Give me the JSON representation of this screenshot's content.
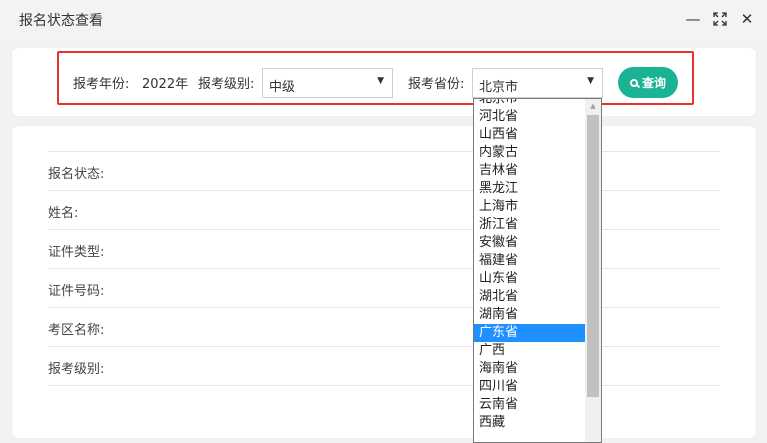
{
  "window": {
    "title": "报名状态查看",
    "minimize_icon": "minimize-icon",
    "maximize_icon": "maximize-icon",
    "close_icon": "close-icon"
  },
  "filters": {
    "year_label": "报考年份:",
    "year_value": "2022年",
    "level_label": "报考级别:",
    "level_selected": "中级",
    "province_label": "报考省份:",
    "province_selected": "北京市",
    "query_button": "查询"
  },
  "details": {
    "status_label": "报名状态:",
    "name_label": "姓名:",
    "id_type_label": "证件类型:",
    "id_number_label": "证件号码:",
    "exam_area_label": "考区名称:",
    "level_label": "报考级别:"
  },
  "province_dropdown": {
    "options": [
      "北京市",
      "河北省",
      "山西省",
      "内蒙古",
      "吉林省",
      "黑龙江",
      "上海市",
      "浙江省",
      "安徽省",
      "福建省",
      "山东省",
      "湖北省",
      "湖南省",
      "广东省",
      "广西",
      "海南省",
      "四川省",
      "云南省",
      "西藏"
    ],
    "highlighted": "广东省"
  },
  "colors": {
    "accent": "#1ab394",
    "highlight_border": "#e8322d",
    "selection": "#1e90ff"
  }
}
